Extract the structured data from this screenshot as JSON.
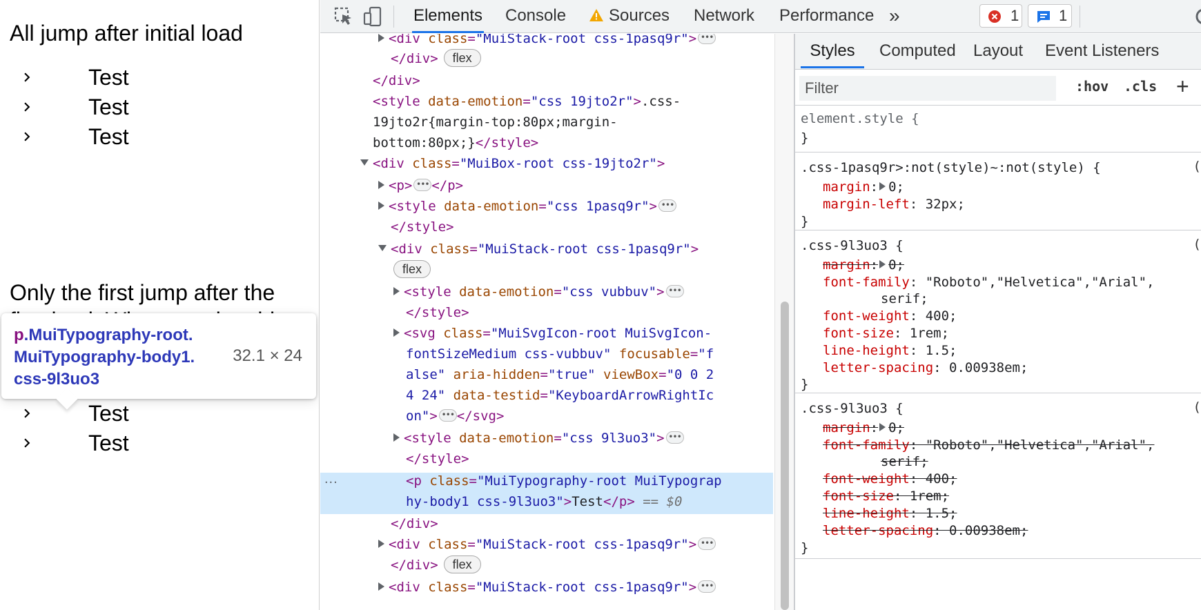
{
  "page": {
    "section1_title": "All jump after initial load",
    "section2_title": "Only the first jump after the",
    "section2_title_line2": "first load. Why wrapping this",
    "rows_label": "Test"
  },
  "tooltip": {
    "tag": "p",
    "line1": ".MuiTypography-root.",
    "line2": "MuiTypography-body1.",
    "line3": "css-9l3uo3",
    "dims": "32.1 × 24"
  },
  "toolbar": {
    "tabs": [
      "Elements",
      "Console",
      "Sources",
      "Network",
      "Performance"
    ],
    "more": "»",
    "errors": "1",
    "messages": "1"
  },
  "elements": {
    "selected_suffix": "== $0",
    "gutter": "..."
  },
  "styles": {
    "tabs": [
      "Styles",
      "Computed",
      "Layout",
      "Event Listeners"
    ],
    "filter_placeholder": "Filter",
    "hov": ":hov",
    "cls": ".cls",
    "plus": "+"
  },
  "colors": {
    "accent": "#1a73e8",
    "selected_row": "#cfe8fc",
    "padding_overlay": "#f7cf9f",
    "content_overlay": "#9fc1e8",
    "tag": "#881280",
    "attr_name": "#994500",
    "attr_value": "#1a1aa6",
    "css_property": "#c80000"
  }
}
